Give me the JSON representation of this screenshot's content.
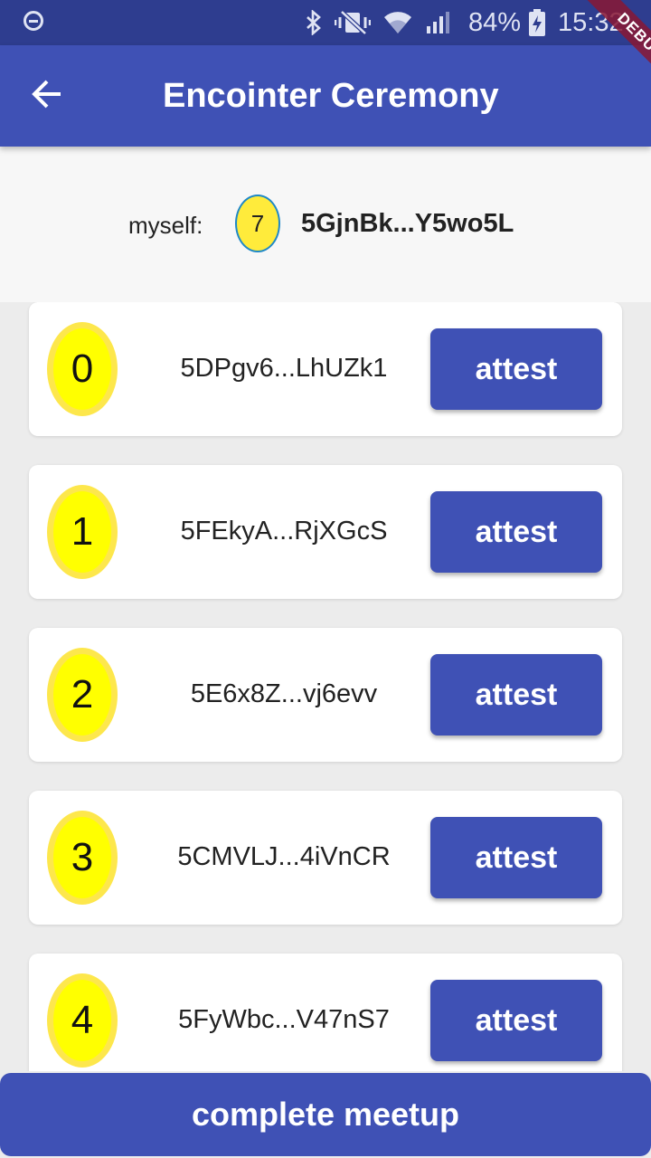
{
  "status_bar": {
    "battery_percent": "84%",
    "time": "15:32",
    "icons": [
      "do-not-disturb-icon",
      "bluetooth-icon",
      "vibrate-icon",
      "wifi-icon",
      "signal-icon",
      "battery-charging-icon"
    ]
  },
  "debug_banner": "DEBUG",
  "app_bar": {
    "title": "Encointer Ceremony",
    "back_icon": "arrow-back-icon"
  },
  "myself": {
    "label": "myself:",
    "index": "7",
    "address": "5GjnBk...Y5wo5L"
  },
  "participants": [
    {
      "index": "0",
      "address": "5DPgv6...LhUZk1",
      "button": "attest"
    },
    {
      "index": "1",
      "address": "5FEkyA...RjXGcS",
      "button": "attest"
    },
    {
      "index": "2",
      "address": "5E6x8Z...vj6evv",
      "button": "attest"
    },
    {
      "index": "3",
      "address": "5CMVLJ...4iVnCR",
      "button": "attest"
    },
    {
      "index": "4",
      "address": "5FyWbc...V47nS7",
      "button": "attest"
    }
  ],
  "complete_button": "complete meetup",
  "colors": {
    "primary": "#3f51b5",
    "status_bar": "#2e3d8f",
    "badge_yellow": "#ffff00",
    "debug_ribbon": "#881834"
  }
}
